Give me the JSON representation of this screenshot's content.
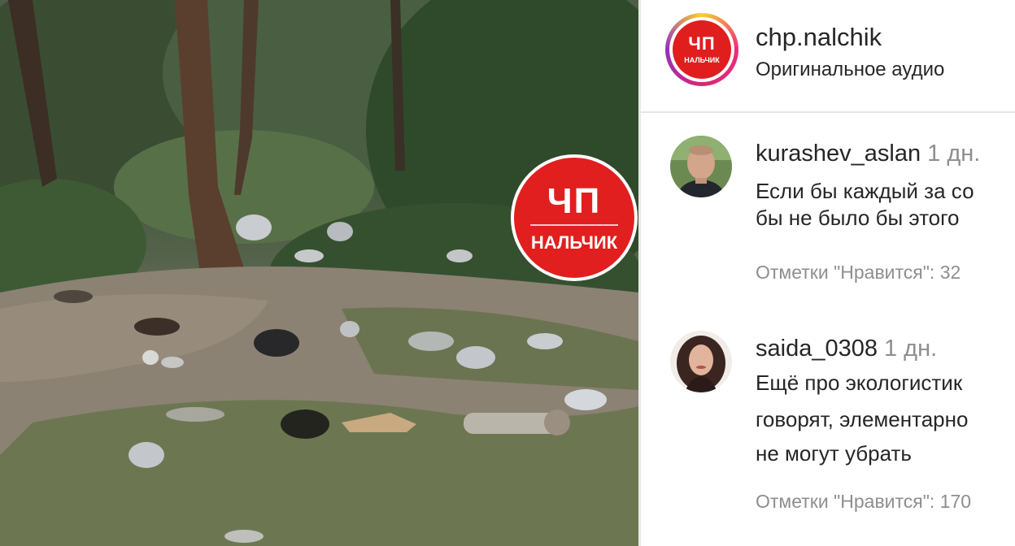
{
  "post": {
    "watermark": {
      "big": "ЧП",
      "city": "НАЛЬЧИК"
    },
    "account": {
      "avatar_big": "ЧП",
      "avatar_city": "НАЛЬЧИК",
      "username": "chp.nalchik",
      "audio": "Оригинальное аудио"
    }
  },
  "comments": [
    {
      "username": "kurashev_aslan",
      "time": "1 дн.",
      "lines": [
        "Если бы каждый за со",
        "бы не было бы этого"
      ],
      "likes": "Отметки \"Нравится\": 32"
    },
    {
      "username": "saida_0308",
      "time": "1 дн.",
      "lines": [
        "Ещё про экологистик",
        "говорят, элементарно",
        "не могут убрать"
      ],
      "likes": "Отметки \"Нравится\": 170"
    }
  ],
  "colors": {
    "badge_red": "#e11f1f",
    "text_primary": "#262626",
    "text_secondary": "#8e8e8e"
  }
}
